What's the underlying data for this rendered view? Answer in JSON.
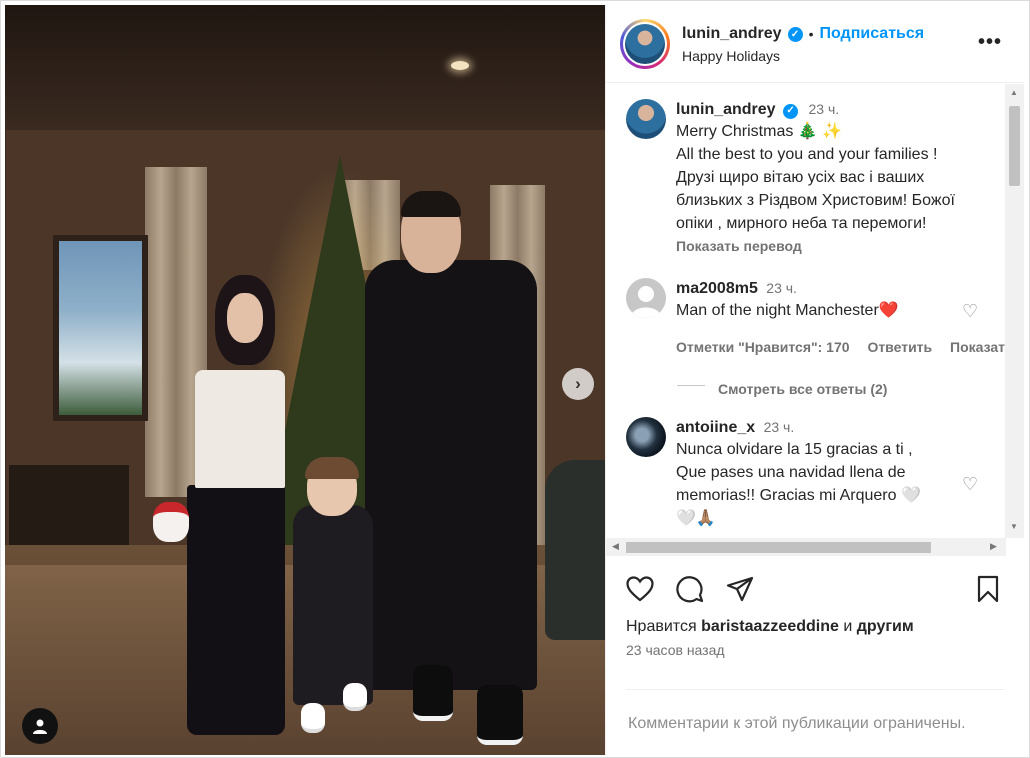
{
  "post": {
    "author": "lunin_andrey",
    "follow_label": "Подписаться",
    "separator": "•",
    "location": "Happy Holidays",
    "more_label": "•••",
    "next_label": "›"
  },
  "caption": {
    "author": "lunin_andrey",
    "time": "23 ч.",
    "lines": [
      "Merry Christmas 🎄 ✨",
      "All the best to you and your families !",
      "Друзі щиро вітаю усіх вас і ваших",
      "близьких з Різдвом Христовим! Божої",
      "опіки , мирного неба та перемоги!"
    ],
    "translate_label": "Показать перевод"
  },
  "comments": [
    {
      "author": "ma2008m5",
      "time": "23 ч.",
      "text": "Man of the night Manchester❤️",
      "likes_label": "Отметки \"Нравится\": 170",
      "reply_label": "Ответить",
      "more_label": "Показать",
      "view_replies_label": "Смотреть все ответы (2)"
    },
    {
      "author": "antoiine_x",
      "time": "23 ч.",
      "lines": [
        "Nunca olvidare la 15 gracias a ti ,",
        "Que pases una navidad llena de",
        "memorias!! Gracias mi Arquero 🤍",
        "🤍🙏🏽"
      ]
    }
  ],
  "footer": {
    "likes_prefix": "Нравится",
    "likes_user": "baristaazzeeddine",
    "likes_and": "и",
    "likes_others": "другим",
    "time_ago": "23 часов назад",
    "comments_restricted": "Комментарии к этой публикации ограничены."
  },
  "colors": {
    "accent": "#0095f6",
    "text": "#262626",
    "muted": "#737373"
  }
}
